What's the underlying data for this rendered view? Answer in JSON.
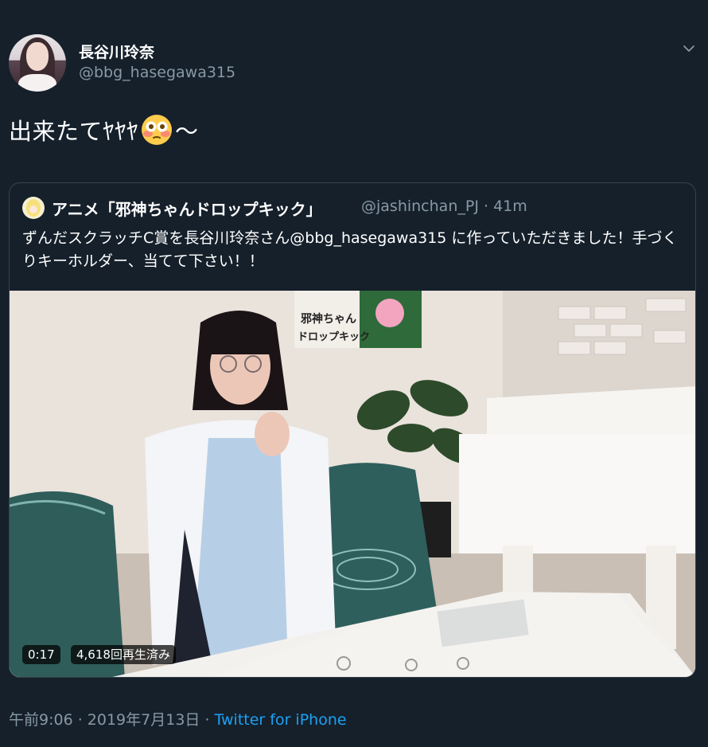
{
  "author": {
    "display_name": "長谷川玲奈",
    "handle": "@bbg_hasegawa315"
  },
  "icons": {
    "menu": "chevron-down-icon",
    "emoji": "flushed-face-emoji"
  },
  "tweet": {
    "text_before_emoji": "出来たてﾔﾔﾔ",
    "text_after_emoji": "～"
  },
  "quote": {
    "name": "アニメ「邪神ちゃんドロップキック」",
    "handle": "@jashinchan_PJ",
    "separator": "·",
    "time": "41m",
    "text": "ずんだスクラッチC賞を長谷川玲奈さん@bbg_hasegawa315 に作っていただきました！手づくりキーホルダー、当てて下さい！！",
    "video": {
      "duration": "0:17",
      "views": "4,618回再生済み",
      "poster_text_1": "邪神ちゃん",
      "poster_text_2": "ドロップキック"
    }
  },
  "footer": {
    "time": "午前9:06",
    "sep1": " · ",
    "date": "2019年7月13日",
    "sep2": " · ",
    "source": "Twitter for iPhone"
  },
  "colors": {
    "background": "#15202b",
    "border": "#38444d",
    "secondary_text": "#8899a6",
    "link": "#1da1f2"
  }
}
